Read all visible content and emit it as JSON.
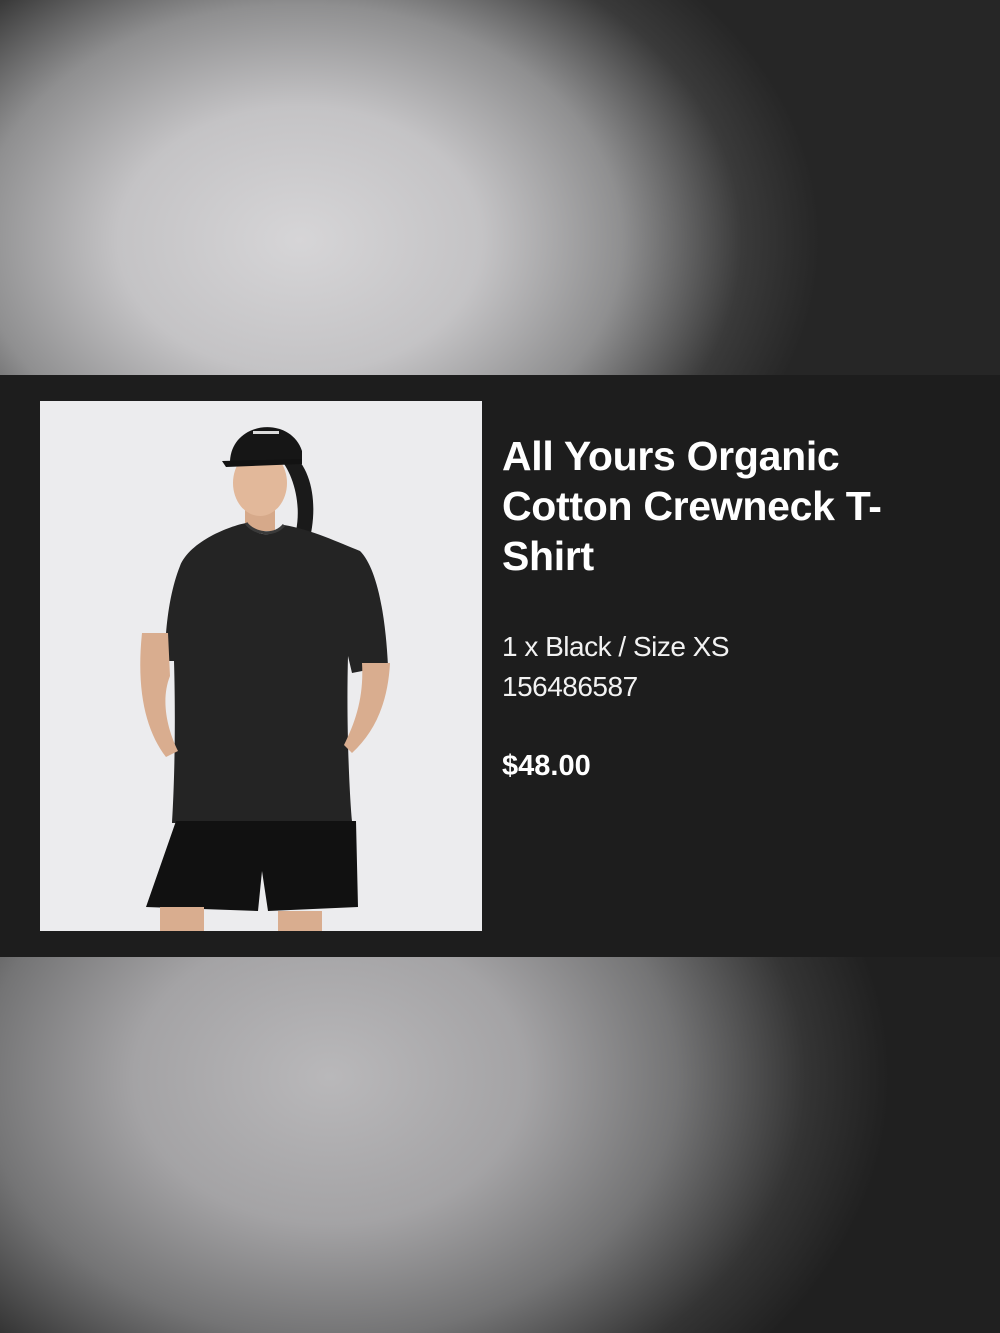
{
  "product": {
    "title": "All Yours Organic Cotton Crewneck T-Shirt",
    "variant": "1 x Black / Size XS",
    "sku": "156486587",
    "price": "$48.00",
    "image_icon": "product-photo-icon"
  },
  "colors": {
    "card_background": "#1d1d1d",
    "text": "#ffffff",
    "image_background": "#ececee"
  }
}
